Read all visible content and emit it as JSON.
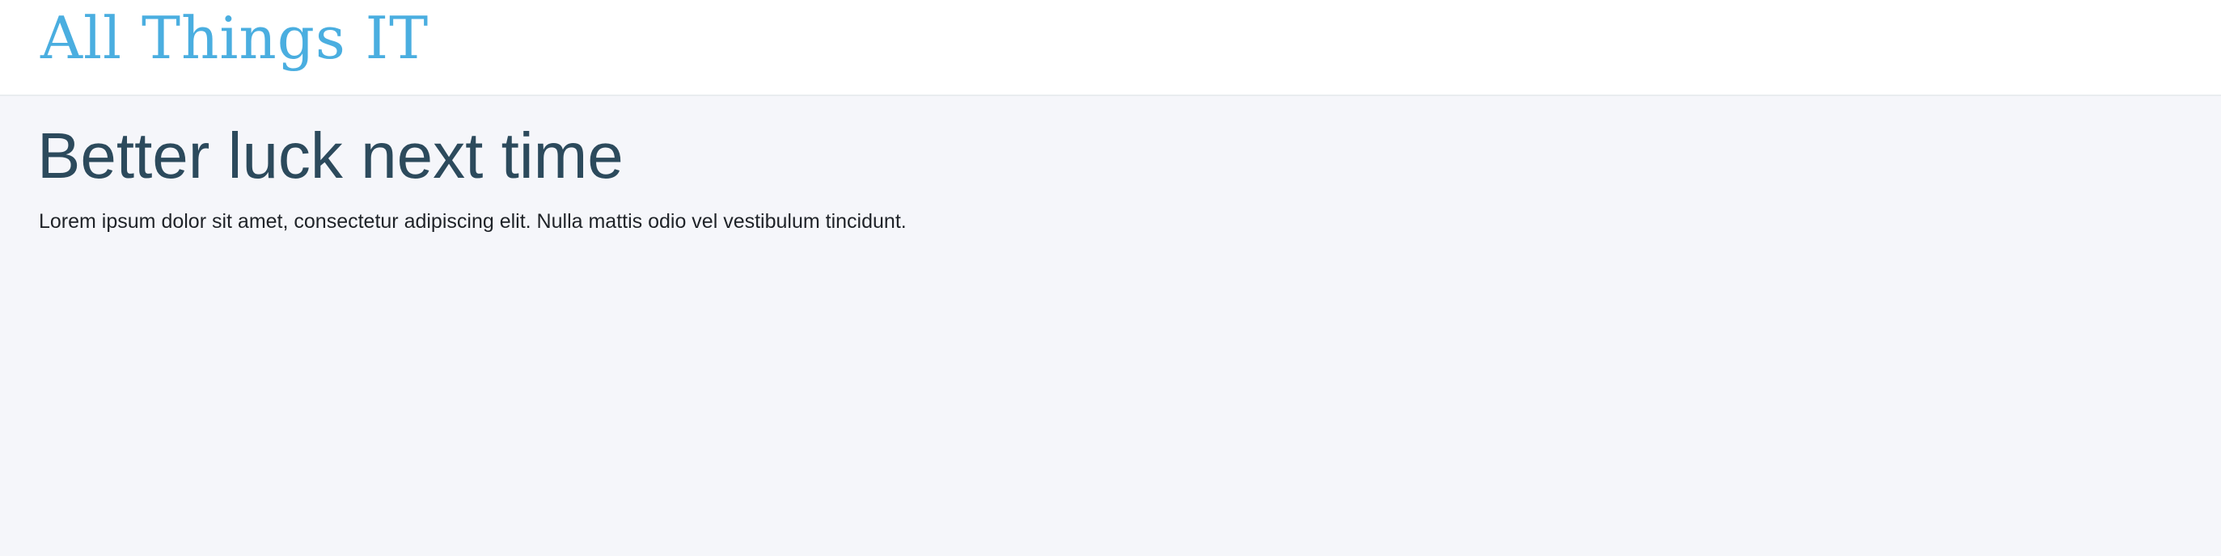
{
  "header": {
    "logo_text": "All Things IT"
  },
  "main": {
    "title": "Better luck next time",
    "paragraph": "Lorem ipsum dolor sit amet, consectetur adipiscing elit. Nulla mattis odio vel vestibulum tincidunt."
  },
  "colors": {
    "brand": "#4aaee0",
    "title": "#2c4a5c",
    "page_background": "#f5f6fa",
    "header_background": "#ffffff"
  }
}
